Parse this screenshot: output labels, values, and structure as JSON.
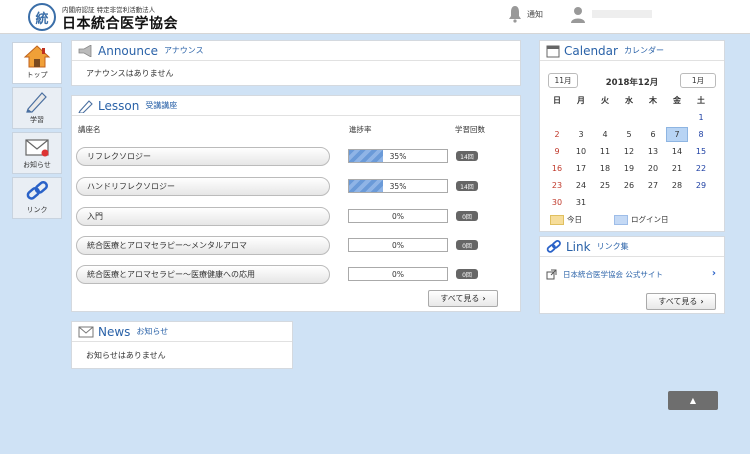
{
  "header": {
    "org_sub": "内閣府認証 特定非営利活動法人",
    "org_name": "日本統合医学協会",
    "logo_text": "統",
    "notification_label": "通知"
  },
  "nav": {
    "items": [
      {
        "label": "トップ",
        "icon": "house-icon"
      },
      {
        "label": "学習",
        "icon": "pencil-icon"
      },
      {
        "label": "お知らせ",
        "icon": "envelope-icon"
      },
      {
        "label": "リンク",
        "icon": "chain-link-icon"
      }
    ]
  },
  "announce": {
    "title_en": "Announce",
    "title_ja": "アナウンス",
    "empty_text": "アナウンスはありません"
  },
  "lesson": {
    "title_en": "Lesson",
    "title_ja": "受講講座",
    "col_name": "講座名",
    "col_progress": "進捗率",
    "col_count": "学習回数",
    "rows": [
      {
        "name": "リフレクソロジー",
        "progress_text": "35%",
        "progress": 0.35,
        "count": "14回"
      },
      {
        "name": "ハンドリフレクソロジー",
        "progress_text": "35%",
        "progress": 0.35,
        "count": "14回"
      },
      {
        "name": "入門",
        "progress_text": "0%",
        "progress": 0,
        "count": "0回"
      },
      {
        "name": "統合医療とアロマセラピー～メンタルアロマ",
        "progress_text": "0%",
        "progress": 0,
        "count": "0回"
      },
      {
        "name": "統合医療とアロマセラピー～医療健康への応用",
        "progress_text": "0%",
        "progress": 0,
        "count": "0回"
      }
    ],
    "see_all": "すべて見る"
  },
  "news": {
    "title_en": "News",
    "title_ja": "お知らせ",
    "empty_text": "お知らせはありません"
  },
  "calendar": {
    "title_en": "Calendar",
    "title_ja": "カレンダー",
    "prev": "11月",
    "month": "2018年12月",
    "next": "1月",
    "weekdays": [
      "日",
      "月",
      "火",
      "水",
      "木",
      "金",
      "土"
    ],
    "weeks": [
      [
        "",
        "",
        "",
        "",
        "",
        "",
        "1"
      ],
      [
        "2",
        "3",
        "4",
        "5",
        "6",
        "7",
        "8"
      ],
      [
        "9",
        "10",
        "11",
        "12",
        "13",
        "14",
        "15"
      ],
      [
        "16",
        "17",
        "18",
        "19",
        "20",
        "21",
        "22"
      ],
      [
        "23",
        "24",
        "25",
        "26",
        "27",
        "28",
        "29"
      ],
      [
        "30",
        "31",
        "",
        "",
        "",
        "",
        ""
      ]
    ],
    "today": "7",
    "legend_today": "今日",
    "legend_login": "ログイン日",
    "today_color": "#f6dd9a",
    "login_color": "#c4d9f5"
  },
  "links": {
    "title_en": "Link",
    "title_ja": "リンク集",
    "items": [
      {
        "label": "日本統合医学協会 公式サイト"
      }
    ],
    "see_all": "すべて見る"
  },
  "scroll_top_label": "▲"
}
